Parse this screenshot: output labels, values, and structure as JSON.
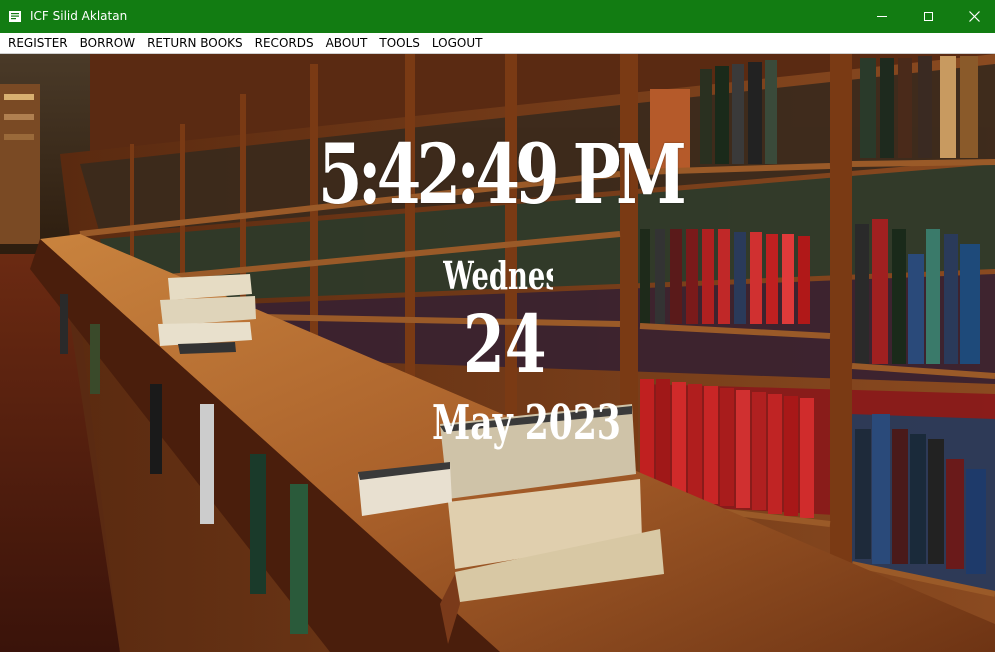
{
  "window": {
    "title": "ICF Silid Aklatan"
  },
  "menu": {
    "items": [
      "REGISTER",
      "BORROW",
      "RETURN BOOKS",
      "RECORDS",
      "ABOUT",
      "TOOLS",
      "LOGOUT"
    ]
  },
  "clock": {
    "time": "5:42:49 PM",
    "day": "Wednes",
    "date": "24",
    "month_year": "May 2023"
  },
  "icons": {
    "app": "book-icon",
    "minimize": "minimize-icon",
    "maximize": "maximize-icon",
    "close": "close-icon"
  },
  "colors": {
    "titlebar": "#127c12",
    "clock_text": "#ffffff"
  }
}
